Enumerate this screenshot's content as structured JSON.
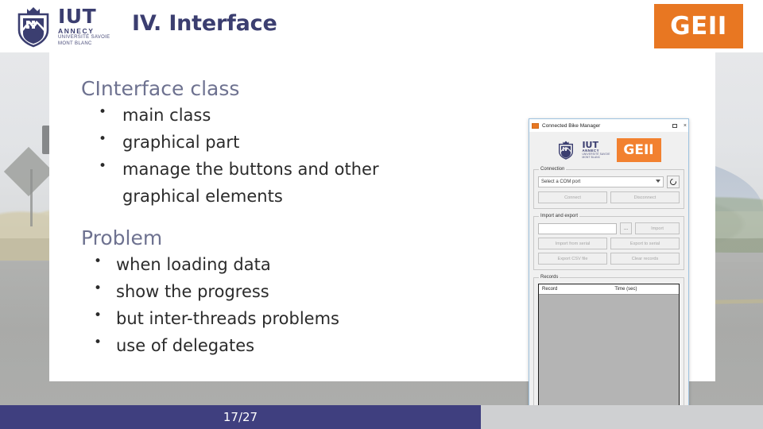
{
  "header": {
    "title": "IV. Interface",
    "badge": "GEII",
    "logo": {
      "name": "IUT",
      "city": "ANNECY",
      "university_line1": "UNIVERSITÉ SAVOIE",
      "university_line2": "MONT BLANC",
      "icon": "iut-shield-icon"
    }
  },
  "content": {
    "section1": {
      "heading": "CInterface class",
      "bullets": [
        "main class",
        "graphical part",
        "manage the buttons and other graphical elements"
      ]
    },
    "section2": {
      "heading": "Problem",
      "bullets": [
        "when loading data",
        "show the progress",
        "but inter-threads problems",
        "use of delegates"
      ]
    }
  },
  "app_window": {
    "title": "Connected Bike Manager",
    "app_icon": "app-orange-icon",
    "window_buttons": {
      "minimize": "minimize-icon",
      "close": "×"
    },
    "branding": {
      "iut": "IUT",
      "annecy": "ANNECY",
      "university_line1": "UNIVERSITÉ SAVOIE",
      "university_line2": "MONT BLANC",
      "geii": "GEII"
    },
    "connection": {
      "legend": "Connection",
      "combo_value": "Select a COM port",
      "refresh_icon": "refresh-icon",
      "connect_label": "Connect",
      "disconnect_label": "Disconnect"
    },
    "import_export": {
      "legend": "Import and export",
      "path_value": "",
      "browse_label": "...",
      "import_label": "Import",
      "import_serial_label": "Import from serial",
      "export_serial_label": "Export to serial",
      "export_csv_label": "Export CSV file",
      "clear_label": "Clear records"
    },
    "records": {
      "legend": "Records",
      "columns": [
        "Record",
        "Time (sec)"
      ],
      "rows": []
    }
  },
  "footer": {
    "page": "17/27"
  },
  "colors": {
    "brand_navy": "#3b3e70",
    "accent_orange": "#e87722",
    "footer_blue": "#3f3f7f",
    "heading_gray": "#6e7290"
  }
}
